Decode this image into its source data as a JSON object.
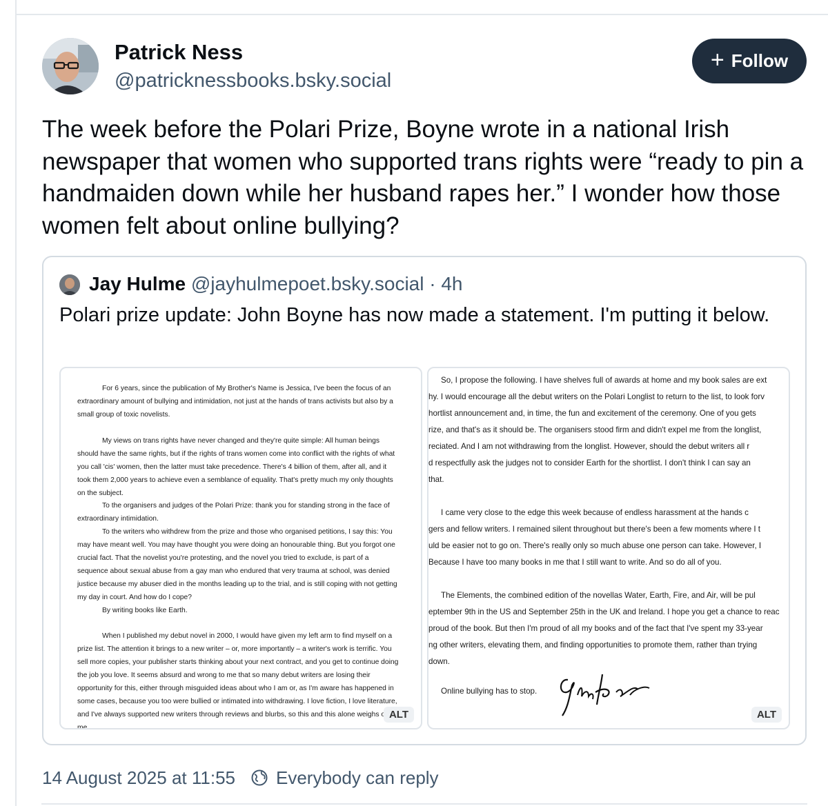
{
  "post": {
    "author_name": "Patrick Ness",
    "author_handle": "@patricknessbooks.bsky.social",
    "follow_label": "Follow",
    "text": "The week before the Polari Prize, Boyne wrote in a national Irish newspaper that women who supported trans rights were “ready to pin a handmaiden down while her husband rapes her.” I wonder how those women felt about online bullying?",
    "timestamp": "14 August 2025 at 11:55",
    "reply_setting": "Everybody can reply"
  },
  "quote": {
    "author_name": "Jay Hulme",
    "author_handle": "@jayhulmepoet.bsky.social · 4h",
    "text": "Polari prize update: John Boyne has now made a statement. I'm putting it below.",
    "images": [
      {
        "alt_label": "ALT",
        "paragraphs": [
          "For 6 years, since the publication of My Brother's Name is Jessica, I've been the focus of an extraordinary amount of bullying and intimidation, not just at the hands of trans activists but also by a small group of toxic novelists.",
          "My views on trans rights have never changed and they're quite simple: All human beings should have the same rights, but if the rights of trans women come into conflict with the rights of what you call 'cis' women, then the latter must take precedence. There's 4 billion of them, after all, and it took them 2,000 years to achieve even a semblance of equality. That's pretty much my only thoughts on the subject.",
          "To the organisers and judges of the Polari Prize: thank you for standing strong in the face of extraordinary intimidation.",
          "To the writers who withdrew from the prize and those who organised petitions, I say this: You may have meant well. You may have thought you were doing an honourable thing. But you forgot one crucial fact. That the novelist you're protesting, and the novel you tried to exclude, is part of a sequence about sexual abuse from a gay man who endured that very trauma at school, was denied justice because my abuser died in the months leading up to the trial, and is still coping with not getting my day in court. And how do I cope?",
          "By writing books like Earth.",
          "When I published my debut novel in 2000, I would have given my left arm to find myself on a prize list. The attention it brings to a new writer – or, more importantly – a writer's work is terrific. You sell more copies, your publisher starts thinking about your next contract, and you get to continue doing the job you love. It seems absurd and wrong to me that so many debut writers are losing their opportunity for this, either through misguided ideas about who I am or, as I'm aware has happened in some cases, because you too were bullied or intimated into withdrawing. I love fiction, I love literature, and I've always supported new writers through reviews and blurbs, so this and this alone weighs on me."
        ]
      },
      {
        "alt_label": "ALT",
        "lines": [
          "So, I propose the following. I have shelves full of awards at home and my book sales are ext",
          "hy. I would encourage all the debut writers on the Polari Longlist to return to the list, to look forv",
          "hortlist announcement and, in time, the fun and excitement of the ceremony. One of you gets",
          "rize, and that's as it should be. The organisers stood firm and didn't expel me from the longlist,",
          "reciated. And I am not withdrawing from the longlist. However, should the debut writers all r",
          "d respectfully ask the judges not to consider Earth for the shortlist. I don't think I can say an",
          "that.",
          "",
          "I came very close to the edge this week because of endless harassment at the hands c",
          "gers and fellow writers. I remained silent throughout but there's been a few moments where I t",
          "uld be easier not to go on. There's really only so much abuse one person can take. However, I",
          "Because I have too many books in me that I still want to write. And so do all of you.",
          "",
          "The Elements, the combined edition of the novellas Water, Earth, Fire, and Air, will be pul",
          "eptember 9th in the US and September 25th in the UK and Ireland. I hope you get a chance to reac",
          "proud of the book. But then I'm proud of all my books and of the fact that I've spent my 33-year",
          "ng other writers, elevating them, and finding opportunities to promote them, rather than trying",
          "down."
        ],
        "closing": "Online bullying has to stop."
      }
    ]
  }
}
